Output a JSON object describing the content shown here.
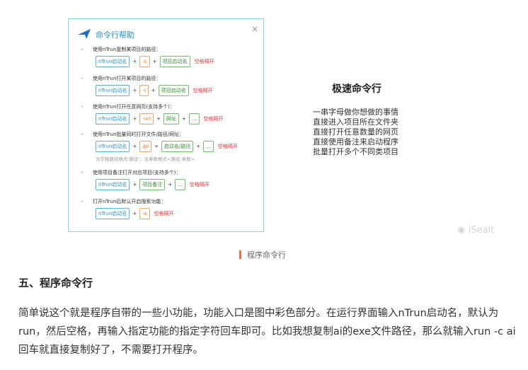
{
  "dialog": {
    "title": "命令行帮助",
    "close": "×",
    "sections": [
      {
        "label": "使用nTrun复制某项目的路径：",
        "chips": [
          {
            "text": "nTrun启动名",
            "color": "blue"
          },
          {
            "text": "-c",
            "color": "orange"
          },
          {
            "text": "项目启动名",
            "color": "green"
          }
        ],
        "hint": "空格隔开"
      },
      {
        "label": "使用nTrun打开某项目的路径：",
        "chips": [
          {
            "text": "nTrun启动名",
            "color": "blue"
          },
          {
            "text": "-l",
            "color": "orange"
          },
          {
            "text": "项目启动名",
            "color": "green"
          }
        ],
        "hint": "空格隔开"
      },
      {
        "label": "使用nTrun打开任意网页(支持多个)：",
        "chips": [
          {
            "text": "nTrun启动名",
            "color": "blue"
          },
          {
            "text": "-url",
            "color": "orange"
          },
          {
            "text": "网址",
            "color": "green"
          },
          {
            "text": "...",
            "color": "green"
          }
        ],
        "hint": "空格隔开"
      },
      {
        "label": "使用nTrun批量同时打开文件/路径/网址：",
        "chips": [
          {
            "text": "nTrun启动名",
            "color": "blue"
          },
          {
            "text": "/pl",
            "color": "orange"
          },
          {
            "text": "启动名/路径",
            "color": "green"
          },
          {
            "text": "...",
            "color": "green"
          }
        ],
        "hint": "空格隔开",
        "note": "含空格路径格式'路径'；含参数格式<路径 参数>"
      },
      {
        "label": "使用项目备注打开对应项目(支持多个)：",
        "chips": [
          {
            "text": "nTrun启动名",
            "color": "blue"
          },
          {
            "text": "项目备注",
            "color": "green"
          },
          {
            "text": "...",
            "color": "green"
          }
        ],
        "hint": "空格隔开"
      },
      {
        "label": "打开nTrun后默认开启搜索功能：",
        "chips": [
          {
            "text": "nTrun启动名",
            "color": "blue"
          },
          {
            "text": "-s",
            "color": "orange"
          }
        ],
        "hint": "空格隔开"
      }
    ]
  },
  "speed": {
    "title": "极速命令行",
    "lines": [
      "一串字母做你想做的事情",
      "直接进入项目所在文件夹",
      "直接打开任意数量的网页",
      "直接使用备注来启动程序",
      "批量打开多个不同类项目"
    ]
  },
  "watermark": "iSealt",
  "caption": "程序命令行",
  "heading": "五、程序命令行",
  "paragraph": "简单说这个就是程序自带的一些小功能，功能入口是图中彩色部分。在运行界面输入nTrun启动名，默认为run，然后空格，再输入指定功能的指定字符回车即可。比如我想复制ai的exe文件路径，那么就输入run -c ai回车就直接复制好了，不需要打开程序。",
  "colors": {
    "accent_blue": "#1f8fd0",
    "hint_red": "#e03030",
    "caption_bar": "#e8704a"
  }
}
